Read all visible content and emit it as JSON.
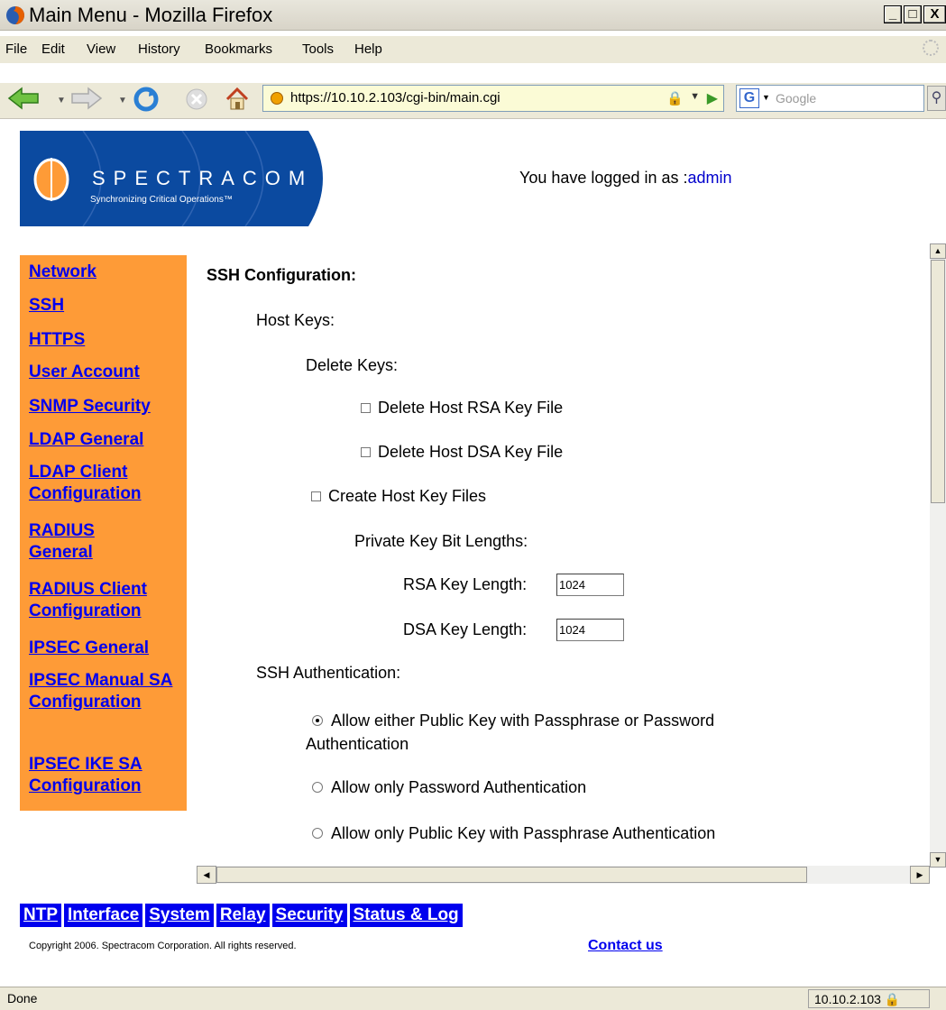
{
  "window": {
    "title": "Main Menu - Mozilla Firefox"
  },
  "menu": [
    "File",
    "Edit",
    "View",
    "History",
    "Bookmarks",
    "Tools",
    "Help"
  ],
  "nav": {
    "url": "https://10.10.2.103/cgi-bin/main.cgi",
    "search_placeholder": "Google"
  },
  "header": {
    "logo_text": "SPECTRACOM",
    "logo_tagline": "Synchronizing Critical Operations™",
    "login_prefix": "You have logged in as :",
    "login_user": "admin"
  },
  "sidebar": {
    "items": [
      "Network",
      "SSH",
      "HTTPS",
      "User Account",
      "SNMP Security",
      "LDAP General",
      "LDAP Client Configuration",
      "RADIUS General",
      "RADIUS Client Configuration",
      "IPSEC General",
      "IPSEC Manual SA Configuration",
      "IPSEC IKE SA Configuration"
    ]
  },
  "content": {
    "heading": "SSH Configuration:",
    "host_keys": "Host Keys:",
    "delete_keys": "Delete Keys:",
    "delete_rsa": "Delete Host RSA Key File",
    "delete_dsa": "Delete Host DSA Key File",
    "create_keys": "Create Host Key Files",
    "key_lengths": "Private Key Bit Lengths:",
    "rsa_label": "RSA Key Length:",
    "rsa_value": "1024",
    "dsa_label": "DSA Key Length:",
    "dsa_value": "1024",
    "auth_heading": "SSH Authentication:",
    "auth_either_1": "Allow either Public Key with Passphrase or Password",
    "auth_either_2": "Authentication",
    "auth_password": "Allow only Password Authentication",
    "auth_pubkey": "Allow only Public Key with Passphrase Authentication",
    "selected_auth": "either"
  },
  "footer": {
    "tabs": [
      "NTP",
      "Interface",
      "System",
      "Relay",
      "Security",
      "Status & Log"
    ],
    "copyright": "Copyright 2006. Spectracom Corporation. All rights reserved.",
    "contact": "Contact us"
  },
  "status": {
    "text": "Done",
    "host": "10.10.2.103"
  }
}
